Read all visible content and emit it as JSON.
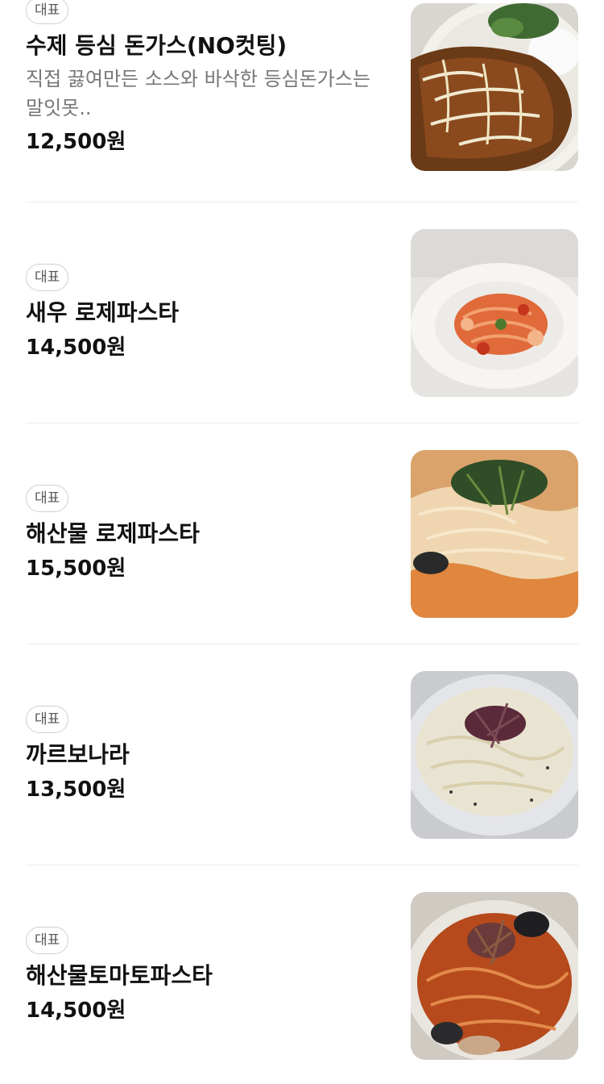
{
  "menu": {
    "items": [
      {
        "badge": "대표",
        "name": "수제 등심 돈가스(NO컷팅)",
        "description": "직접 끓여만든 소스와 바삭한 등심돈가스는 말잇못..",
        "price": "12,500원",
        "image": "pork-cutlet-image"
      },
      {
        "badge": "대표",
        "name": "새우 로제파스타",
        "description": "",
        "price": "14,500원",
        "image": "shrimp-rose-pasta-image"
      },
      {
        "badge": "대표",
        "name": "해산물 로제파스타",
        "description": "",
        "price": "15,500원",
        "image": "seafood-rose-pasta-image"
      },
      {
        "badge": "대표",
        "name": "까르보나라",
        "description": "",
        "price": "13,500원",
        "image": "carbonara-image"
      },
      {
        "badge": "대표",
        "name": "해산물토마토파스타",
        "description": "",
        "price": "14,500원",
        "image": "seafood-tomato-pasta-image"
      }
    ]
  }
}
